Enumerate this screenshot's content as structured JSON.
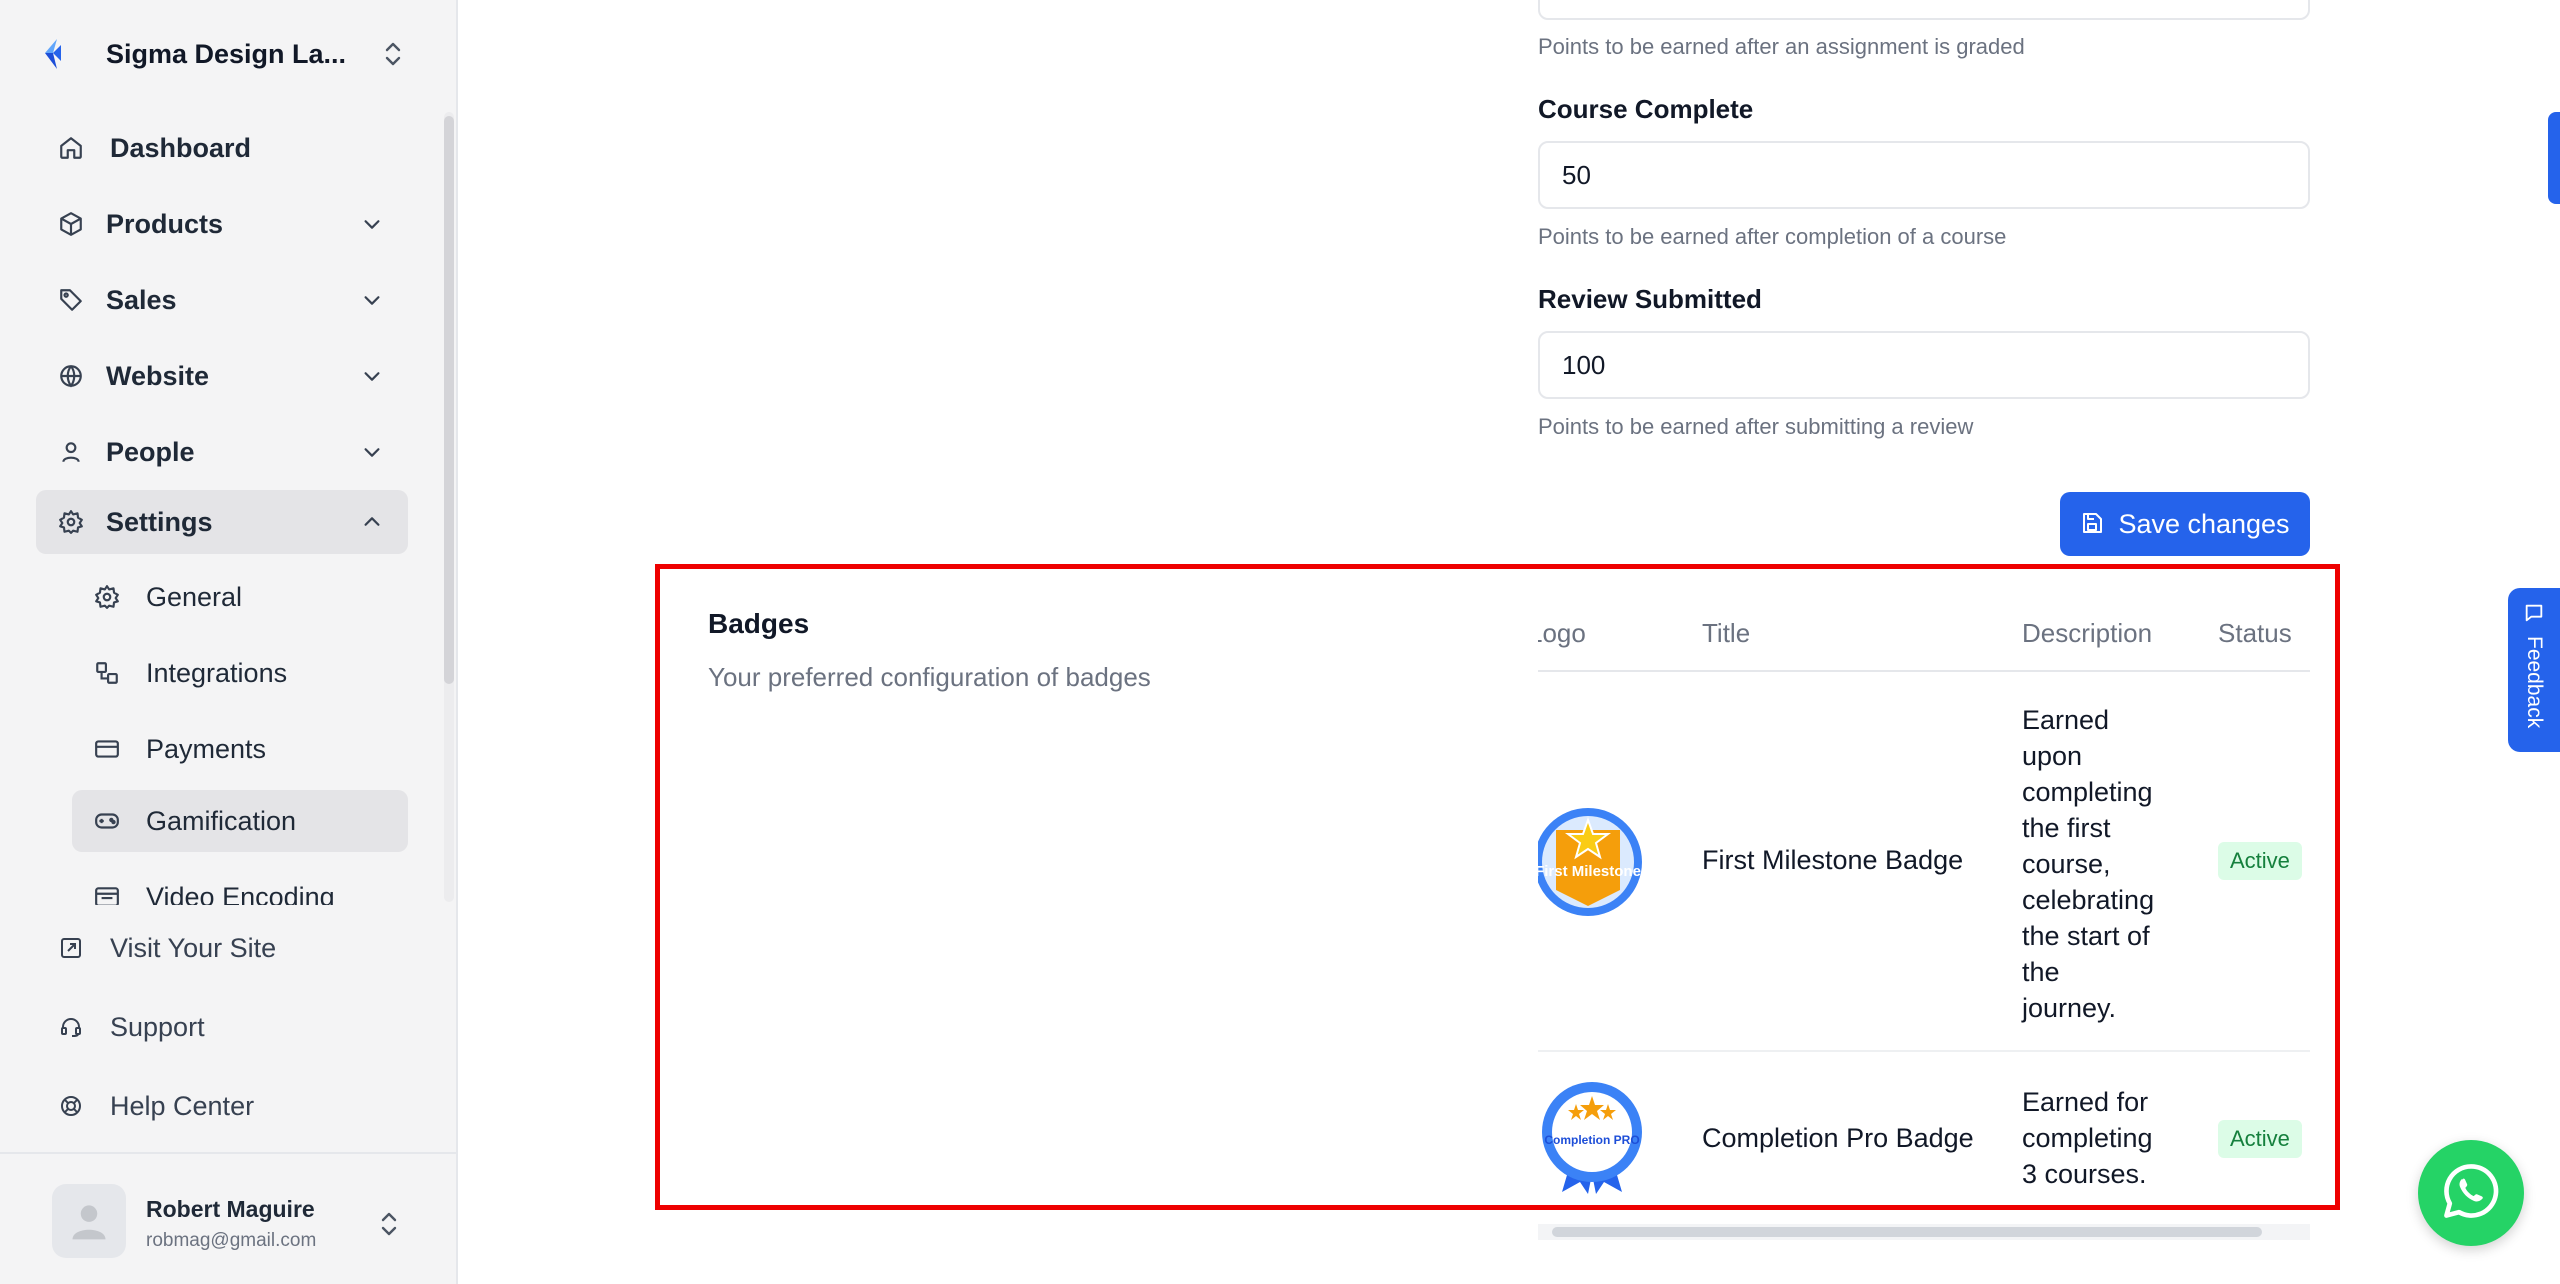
{
  "colors": {
    "accent": "#2563eb",
    "highlight": "#ee0000",
    "whatsapp": "#25d366",
    "active_badge_bg": "#dcfce7",
    "active_badge_text": "#15803d"
  },
  "sidebar": {
    "brand": {
      "name": "Sigma Design La...",
      "logo_icon": "brand-logo-icon",
      "switch_icon": "chevrons-up-down-icon"
    },
    "nav": [
      {
        "label": "Dashboard",
        "icon": "home-icon"
      },
      {
        "label": "Products",
        "icon": "box-icon",
        "expandable": true
      },
      {
        "label": "Sales",
        "icon": "tag-icon",
        "expandable": true
      },
      {
        "label": "Website",
        "icon": "globe-icon",
        "expandable": true
      },
      {
        "label": "People",
        "icon": "user-icon",
        "expandable": true
      },
      {
        "label": "Settings",
        "icon": "gear-icon",
        "expanded": true
      }
    ],
    "settings_sub": [
      {
        "label": "General",
        "icon": "gear-icon"
      },
      {
        "label": "Integrations",
        "icon": "integrations-icon"
      },
      {
        "label": "Payments",
        "icon": "credit-card-icon"
      },
      {
        "label": "Gamification",
        "icon": "gamepad-icon",
        "active": true
      },
      {
        "label": "Video Encoding",
        "icon": "video-encoding-icon"
      }
    ],
    "bottom": [
      {
        "label": "Visit Your Site",
        "icon": "external-link-icon"
      },
      {
        "label": "Support",
        "icon": "headset-icon"
      },
      {
        "label": "Help Center",
        "icon": "lifebuoy-icon"
      }
    ],
    "user": {
      "name": "Robert Maguire",
      "email": "robmag@gmail.com"
    }
  },
  "points": {
    "assignment_help": "Points to be earned after an assignment is graded",
    "course_complete": {
      "label": "Course Complete",
      "value": "50",
      "help": "Points to be earned after completion of a course"
    },
    "review_submitted": {
      "label": "Review Submitted",
      "value": "100",
      "help": "Points to be earned after submitting a review"
    },
    "save_label": "Save changes"
  },
  "badges": {
    "title": "Badges",
    "subtitle": "Your preferred configuration of badges",
    "columns": {
      "logo": "Logo",
      "title": "Title",
      "description": "Description",
      "status": "Status"
    },
    "rows": [
      {
        "logo_text": "First Milestone",
        "title": "First Milestone Badge",
        "description_lines": [
          "Earned",
          "upon",
          "completing",
          "the first",
          "course,",
          "celebrating",
          "the start of",
          "the",
          "journey."
        ],
        "status": "Active"
      },
      {
        "logo_text": "Completion PRO",
        "title": "Completion Pro Badge",
        "description_lines": [
          "Earned for",
          "completing",
          "3 courses."
        ],
        "status": "Active"
      }
    ]
  },
  "feedback": {
    "label": "Feedback"
  }
}
